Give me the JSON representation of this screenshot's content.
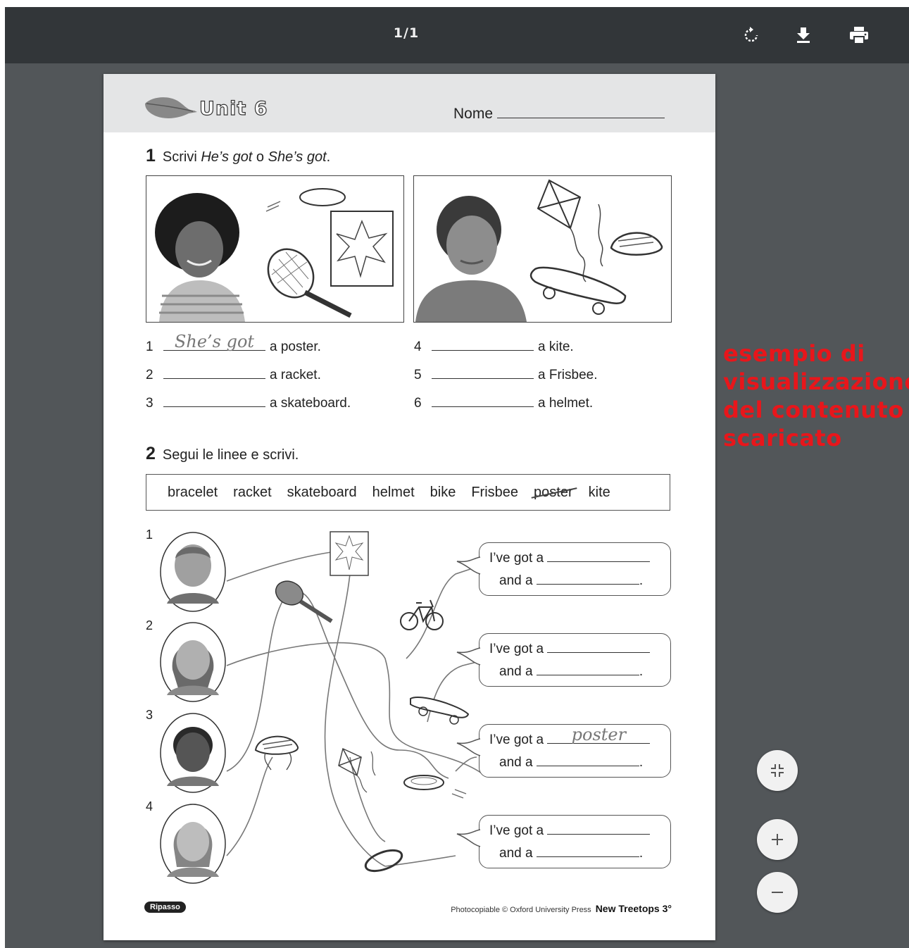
{
  "toolbar": {
    "page_counter": "1/1",
    "icons": [
      "rotate-icon",
      "download-icon",
      "print-icon"
    ]
  },
  "worksheet": {
    "unit_title": "Unit 6",
    "name_label": "Nome",
    "exercise1": {
      "number": "1",
      "instruction_prefix": "Scrivi ",
      "instruction_a": "He’s got",
      "instruction_mid": " o ",
      "instruction_b": "She’s got",
      "instruction_end": ".",
      "sentences": [
        {
          "n": "1",
          "answer": "She’s got",
          "rest": "a poster."
        },
        {
          "n": "2",
          "answer": "",
          "rest": "a racket."
        },
        {
          "n": "3",
          "answer": "",
          "rest": "a skateboard."
        },
        {
          "n": "4",
          "answer": "",
          "rest": "a kite."
        },
        {
          "n": "5",
          "answer": "",
          "rest": "a Frisbee."
        },
        {
          "n": "6",
          "answer": "",
          "rest": "a helmet."
        }
      ]
    },
    "exercise2": {
      "number": "2",
      "instruction": "Segui le linee e scrivi.",
      "words": [
        "bracelet",
        "racket",
        "skateboard",
        "helmet",
        "bike",
        "Frisbee",
        "poster",
        "kite"
      ],
      "struck_word": "poster",
      "kids": [
        "1",
        "2",
        "3",
        "4"
      ],
      "bubbles": [
        {
          "line1": "I’ve got a",
          "answer": "",
          "line2": "and a",
          "end": "."
        },
        {
          "line1": "I’ve got a",
          "answer": "",
          "line2": "and a",
          "end": "."
        },
        {
          "line1": "I’ve got a",
          "answer": "poster",
          "line2": "and a",
          "end": "."
        },
        {
          "line1": "I’ve got a",
          "answer": "",
          "line2": "and a",
          "end": "."
        }
      ]
    },
    "footer": {
      "badge": "Ripasso",
      "copyright": "Photocopiable © Oxford University Press",
      "book": "New Treetops 3°"
    }
  },
  "annotation": "esempio di visualizzazione del contenuto scaricato",
  "controls": [
    "fit-icon",
    "zoom-in-icon",
    "zoom-out-icon"
  ],
  "colors": {
    "toolbar": "#323639",
    "background": "#525659",
    "annotation": "#e8161b"
  }
}
